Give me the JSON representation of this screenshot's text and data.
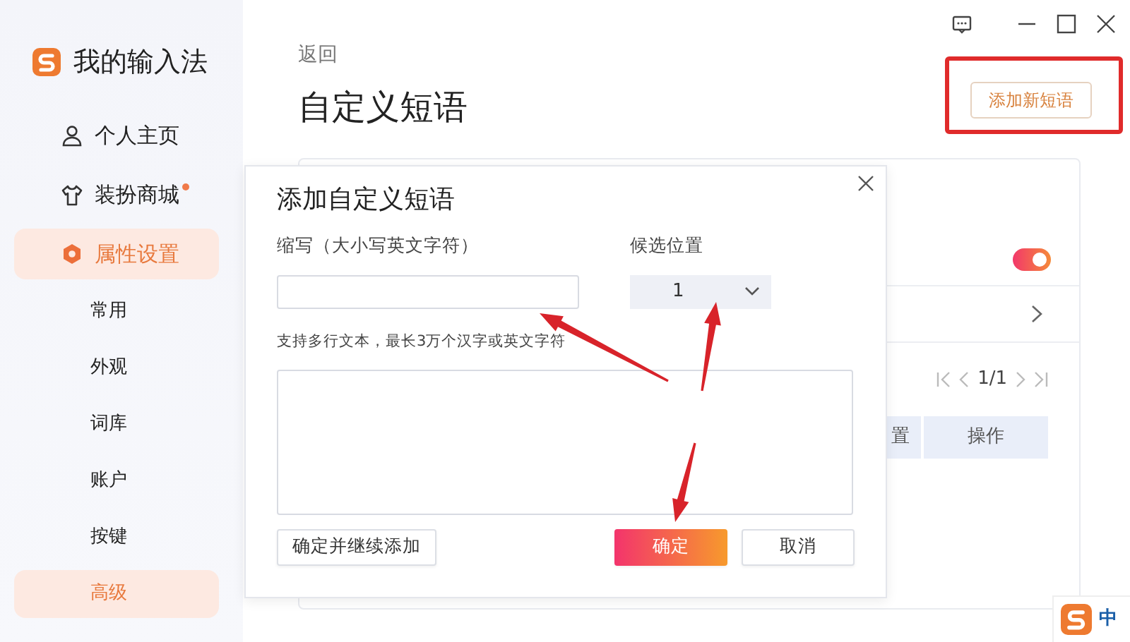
{
  "app": {
    "name": "我的输入法"
  },
  "sidebar": {
    "items": [
      {
        "label": "个人主页",
        "kind": "profile",
        "selected": false,
        "dot": false
      },
      {
        "label": "装扮商城",
        "kind": "store",
        "selected": false,
        "dot": true
      },
      {
        "label": "属性设置",
        "kind": "settings",
        "selected": true,
        "dot": false
      },
      {
        "label": "常用",
        "kind": "sub",
        "selected": false,
        "dot": false
      },
      {
        "label": "外观",
        "kind": "sub",
        "selected": false,
        "dot": false
      },
      {
        "label": "词库",
        "kind": "sub",
        "selected": false,
        "dot": false
      },
      {
        "label": "账户",
        "kind": "sub",
        "selected": false,
        "dot": false
      },
      {
        "label": "按键",
        "kind": "sub",
        "selected": false,
        "dot": false
      },
      {
        "label": "高级",
        "kind": "sub",
        "selected": true,
        "dot": false
      }
    ]
  },
  "page": {
    "back": "返回",
    "title": "自定义短语",
    "add_button": "添加新短语"
  },
  "panel": {
    "toggle_on": true,
    "pagination": "1/1",
    "table": {
      "columns": [
        "置",
        "操作"
      ]
    }
  },
  "dialog": {
    "title": "添加自定义短语",
    "abbr_label": "缩写（大小写英文字符）",
    "position_label": "候选位置",
    "position_value": "1",
    "content_hint": "支持多行文本，最长3万个汉字或英文字符",
    "buttons": [
      {
        "label": "确定并继续添加",
        "kind": "secondary"
      },
      {
        "label": "确定",
        "kind": "primary"
      },
      {
        "label": "取消",
        "kind": "secondary"
      }
    ]
  },
  "taskbar": {
    "ime_mode": "中"
  }
}
